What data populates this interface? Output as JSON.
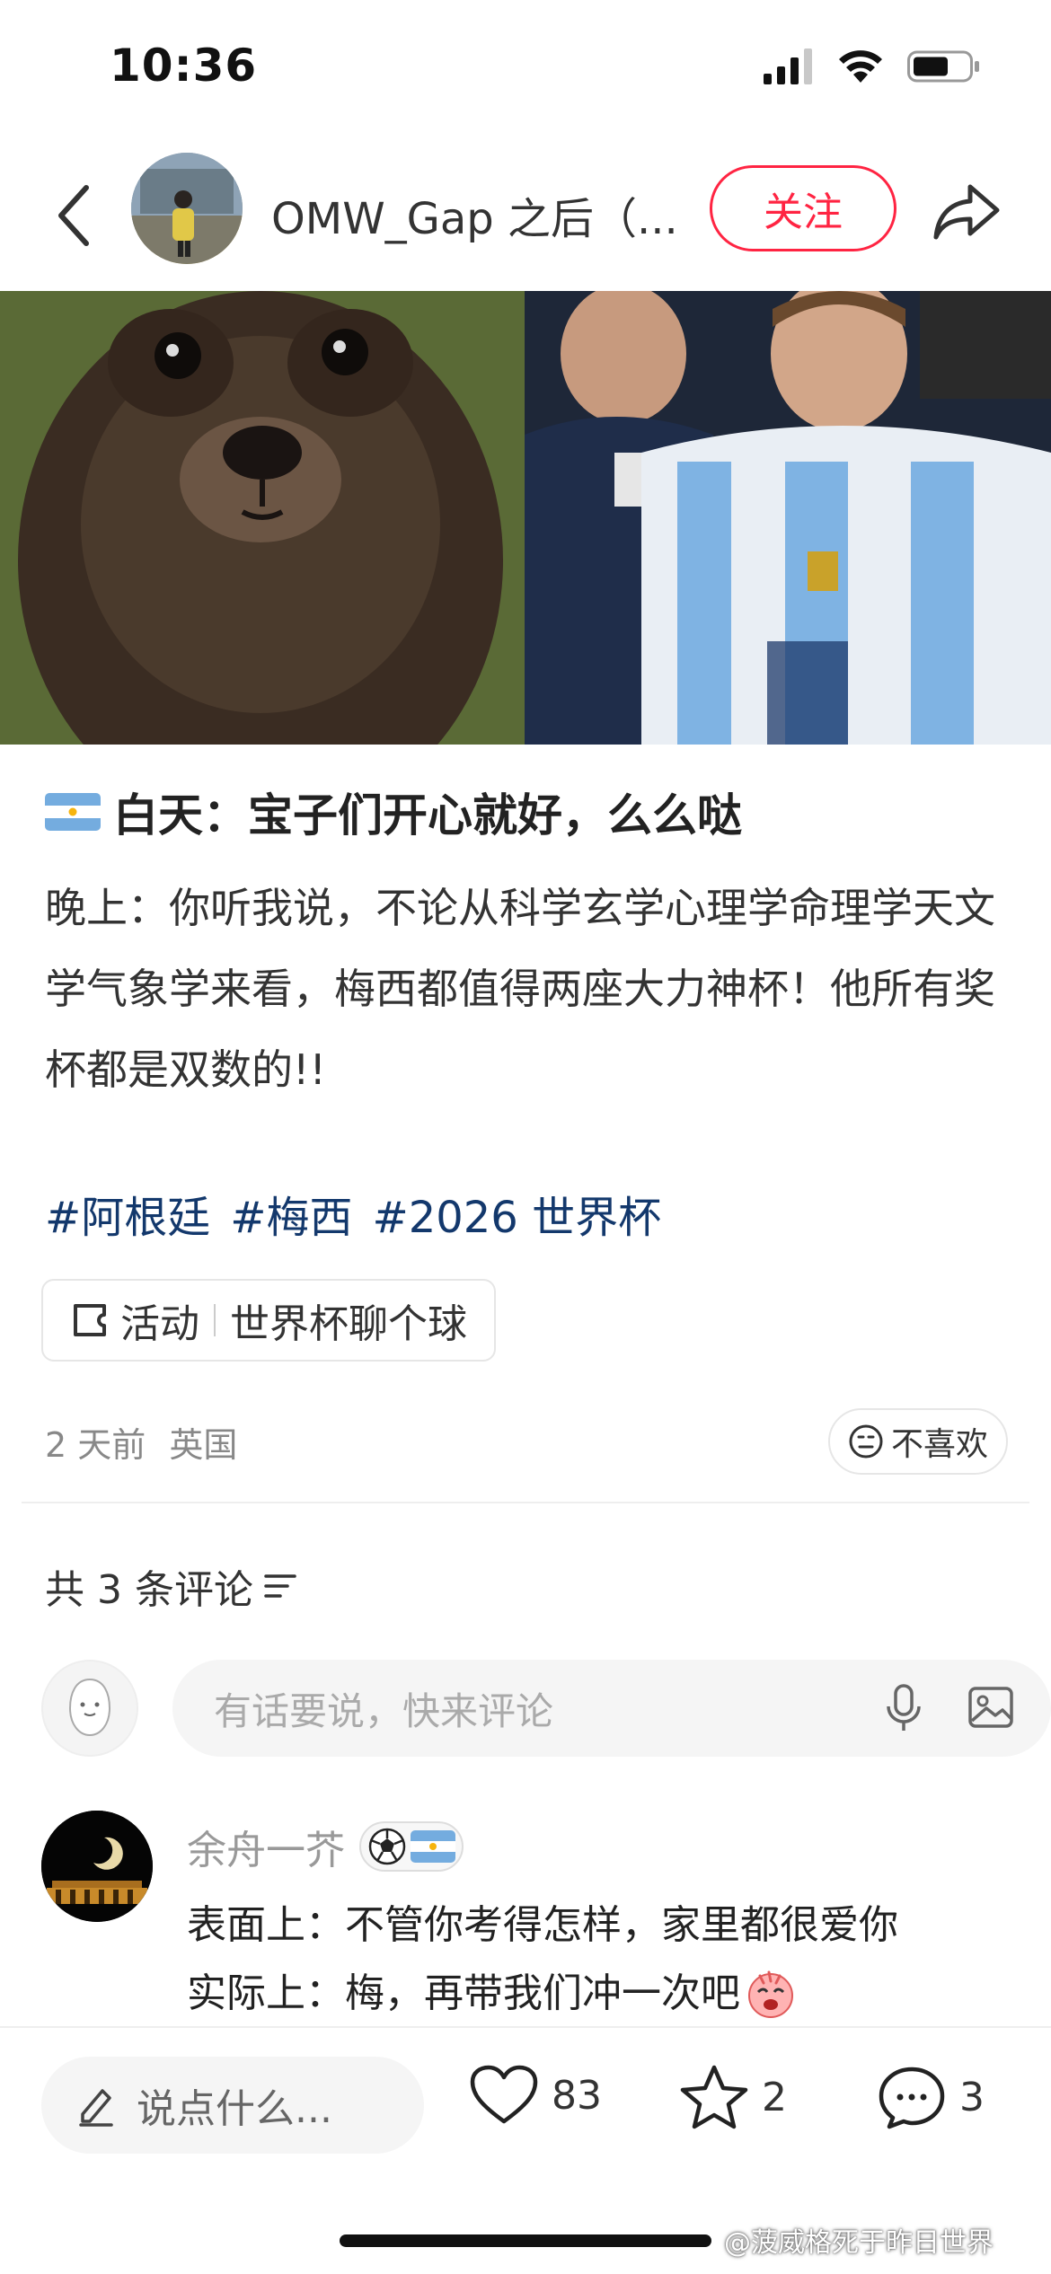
{
  "status_bar": {
    "time": "10:36"
  },
  "header": {
    "author_name": "OMW_Gap 之后（...",
    "follow_label": "关注"
  },
  "post": {
    "title": "白天：宝子们开心就好，么么哒",
    "body": "晚上：你听我说，不论从科学玄学心理学命理学天文学气象学来看，梅西都值得两座大力神杯！他所有奖杯都是双数的!!",
    "tags": [
      "#阿根廷",
      "#梅西",
      "#2026 世界杯"
    ],
    "activity": {
      "label": "活动",
      "name": "世界杯聊个球"
    },
    "time": "2 天前",
    "location": "英国",
    "dislike_label": "不喜欢"
  },
  "comments_section": {
    "count_label": "共 3 条评论",
    "input_placeholder": "有话要说，快来评论"
  },
  "comments": [
    {
      "user": "余舟一芥",
      "line1": "表面上：不管你考得怎样，家里都很爱你",
      "line2": "实际上：梅，再带我们冲一次吧"
    }
  ],
  "bottom_bar": {
    "say_placeholder": "说点什么...",
    "likes": "83",
    "stars": "2",
    "comments": "3"
  },
  "watermark": "@菠威格死于昨日世界",
  "colors": {
    "accent": "#ff2442",
    "tag": "#13386c",
    "argentina_blue": "#74acdf"
  }
}
